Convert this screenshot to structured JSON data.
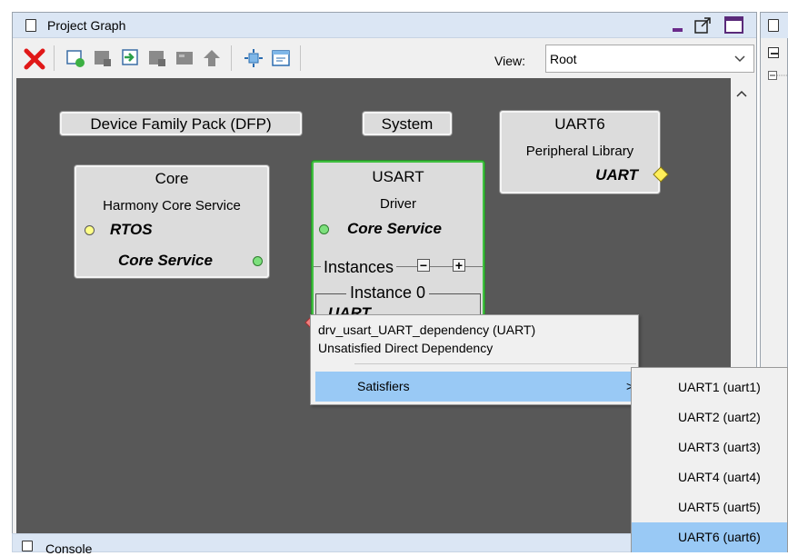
{
  "window": {
    "title": "Project Graph",
    "controls": [
      "minimize-icon",
      "popout-icon",
      "maximize-icon"
    ]
  },
  "toolbar": {
    "buttons": [
      "delete-icon",
      "add-component-icon",
      "group-icon",
      "import-icon",
      "ungroup-icon",
      "export-icon",
      "up-icon",
      "fit-icon",
      "window-icon"
    ],
    "view_label": "View:",
    "view_value": "Root"
  },
  "graph": {
    "dfp": "Device Family Pack (DFP)",
    "system": "System",
    "uart6": {
      "title": "UART6",
      "subtitle": "Peripheral Library",
      "port": "UART"
    },
    "core": {
      "title": "Core",
      "subtitle": "Harmony Core Service",
      "port1": "RTOS",
      "port2": "Core Service"
    },
    "usart": {
      "title": "USART",
      "subtitle": "Driver",
      "port": "Core Service",
      "instances_label": "Instances",
      "instance0": "Instance 0",
      "instance_port": "UART"
    }
  },
  "context_menu": {
    "line1": "drv_usart_UART_dependency (UART)",
    "line2": "Unsatisfied Direct Dependency",
    "satisfiers": "Satisfiers",
    "arrow": ">"
  },
  "submenu": {
    "items": [
      "UART1 (uart1)",
      "UART2 (uart2)",
      "UART3 (uart3)",
      "UART4 (uart4)",
      "UART5 (uart5)",
      "UART6 (uart6)"
    ],
    "selected_index": 5
  },
  "console": {
    "title": "Console"
  },
  "colors": {
    "selection": "#99c9f5",
    "canvas": "#585858",
    "titlebar": "#dbe6f4",
    "active_border": "#3fbf3f"
  }
}
